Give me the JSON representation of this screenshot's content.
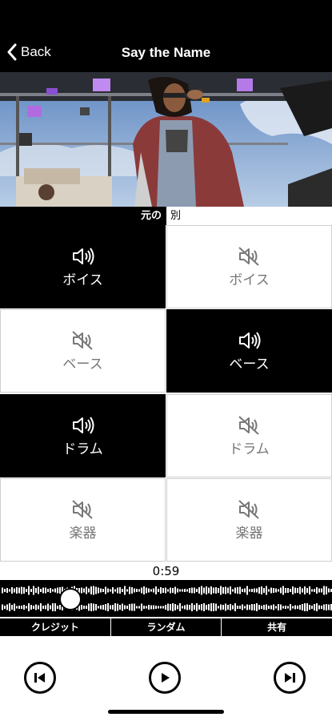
{
  "nav": {
    "back_label": "Back",
    "title": "Say the Name"
  },
  "segment": {
    "left_label": "元の",
    "right_label": "別"
  },
  "tracks": [
    {
      "label": "ボイス",
      "left_state": "on",
      "right_state": "off"
    },
    {
      "label": "ベース",
      "left_state": "off",
      "right_state": "on"
    },
    {
      "label": "ドラム",
      "left_state": "on",
      "right_state": "off"
    },
    {
      "label": "楽器",
      "left_state": "off",
      "right_state": "off"
    }
  ],
  "playback": {
    "time": "0:59",
    "progress": 0.2
  },
  "tabs": [
    "クレジット",
    "ランダム",
    "共有"
  ],
  "controls": {
    "previous": "skip-previous-icon",
    "play": "play-icon",
    "next": "skip-next-icon"
  }
}
